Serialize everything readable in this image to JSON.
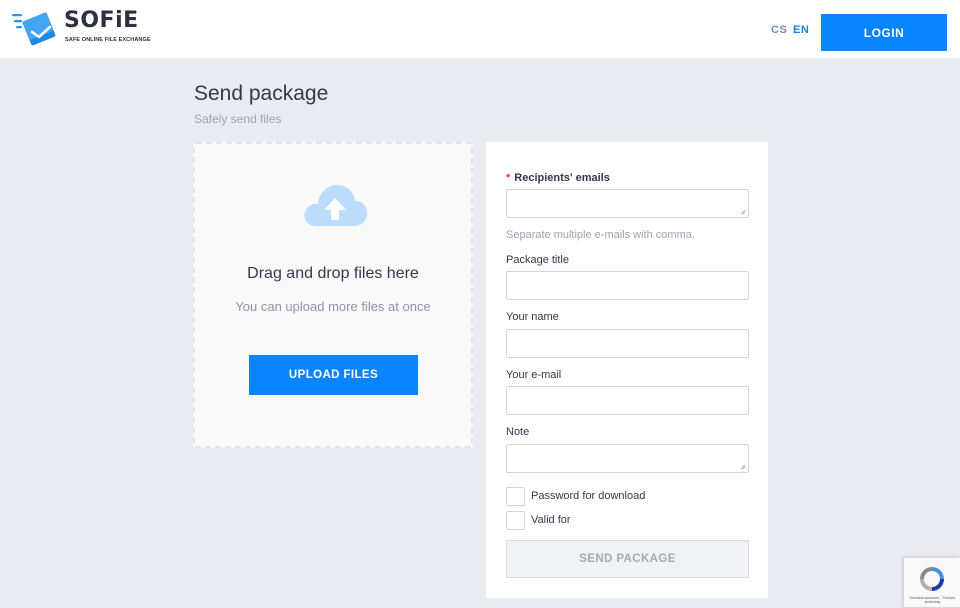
{
  "header": {
    "logo_title": "SOFiE",
    "logo_subtitle": "SAFE ONLINE FILE EXCHANGE",
    "languages": [
      "CS",
      "EN"
    ],
    "active_language": "EN",
    "login_label": "LOGIN"
  },
  "page": {
    "title": "Send package",
    "subtitle": "Safely send files"
  },
  "dropzone": {
    "title": "Drag and drop files here",
    "subtitle": "You can upload more files at once",
    "upload_label": "UPLOAD FILES"
  },
  "form": {
    "recipients_label": "Recipients' emails",
    "recipients_hint": "Separate multiple e-mails with comma.",
    "package_title_label": "Package title",
    "your_name_label": "Your name",
    "your_email_label": "Your e-mail",
    "note_label": "Note",
    "password_label": "Password for download",
    "valid_for_label": "Valid for",
    "send_label": "SEND PACKAGE"
  },
  "recaptcha": {
    "text": "Ochrana soukromí - Smluvní podmínky"
  },
  "colors": {
    "accent": "#0a84ff",
    "background": "#e9ebf3",
    "required": "#e53935"
  }
}
